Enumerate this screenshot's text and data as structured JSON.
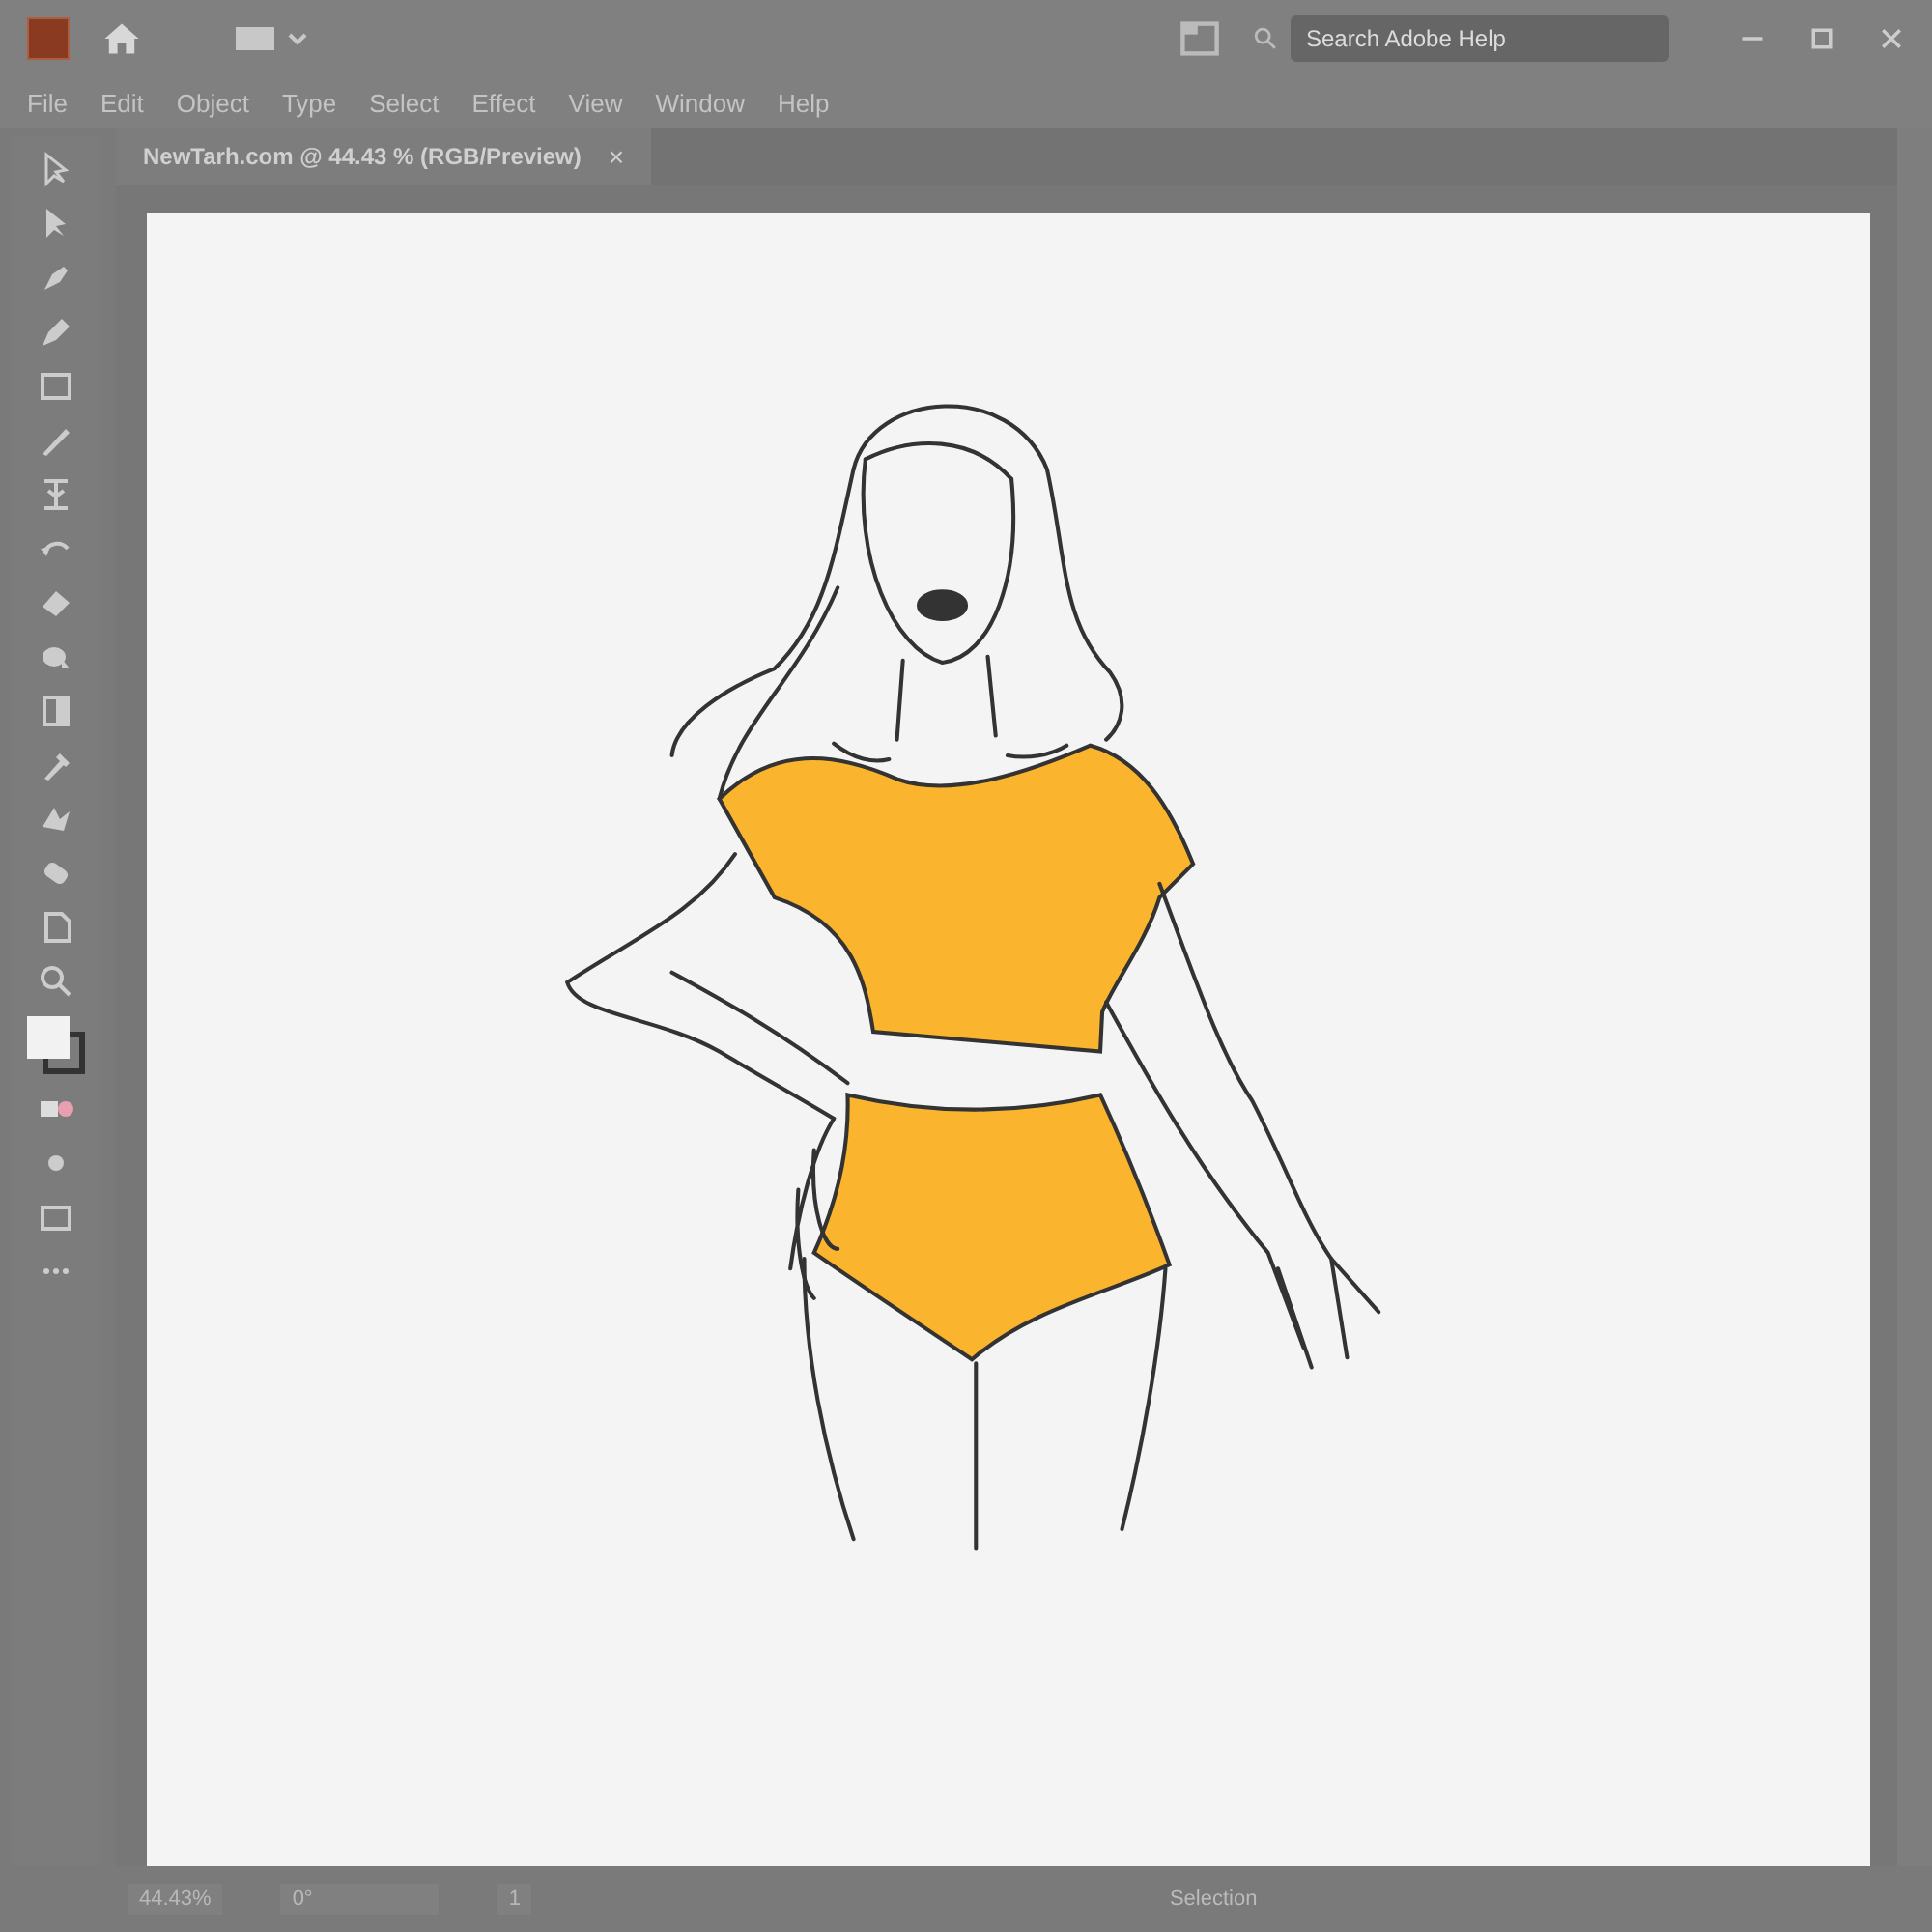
{
  "menu": [
    "File",
    "Edit",
    "Object",
    "Type",
    "Select",
    "Effect",
    "View",
    "Window",
    "Help"
  ],
  "search": {
    "placeholder": "Search Adobe Help"
  },
  "document_tabs": [
    {
      "title": "NewTarh.com @ 44.43 % (RGB/Preview)",
      "close": "×",
      "selected": true
    }
  ],
  "status_bar": {
    "zoom": "44.43%",
    "rotation": "0°",
    "artboard": "1",
    "tool": "Selection"
  }
}
